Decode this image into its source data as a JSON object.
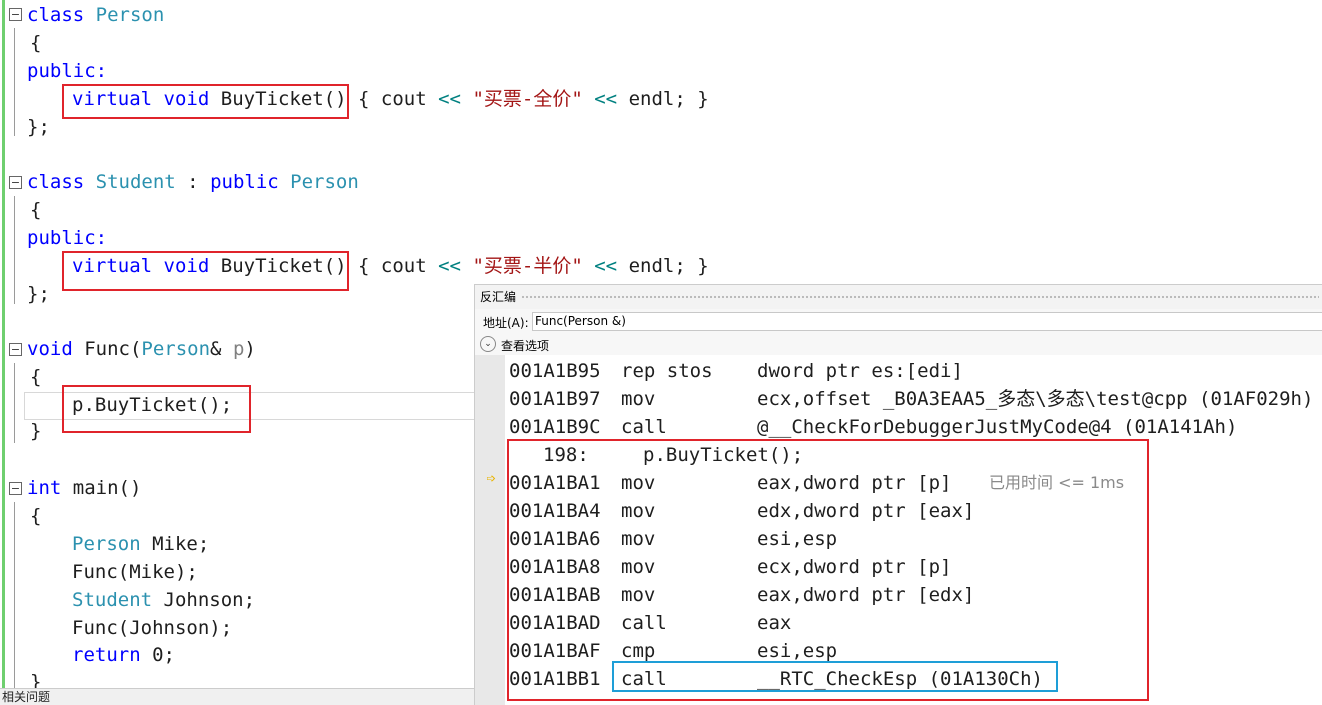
{
  "code": {
    "person_class": {
      "line1": {
        "kw": "class",
        "name": "Person"
      },
      "open": "{",
      "access": "public:",
      "method": {
        "virtual": "virtual",
        "void": "void",
        "name": "BuyTicket()",
        "body_open": " { cout ",
        "op1": "<<",
        "str": "\"买票-全价\"",
        "op2": "<<",
        "tail": " endl; }"
      },
      "close": "};"
    },
    "student_class": {
      "line1": {
        "kw": "class",
        "name": "Student",
        "colon": " : ",
        "public": "public",
        "base": "Person"
      },
      "open": "{",
      "access": "public:",
      "method": {
        "virtual": "virtual",
        "void": "void",
        "name": "BuyTicket()",
        "body_open": " { cout ",
        "op1": "<<",
        "str": "\"买票-半价\"",
        "op2": "<<",
        "tail": " endl; }"
      },
      "close": "};"
    },
    "func": {
      "sig": {
        "void": "void",
        "name": " Func(",
        "type": "Person",
        "amp": "& ",
        "param": "p",
        "close": ")"
      },
      "open": "{",
      "call": "p.BuyTicket();",
      "close": "}"
    },
    "main": {
      "sig": {
        "int": "int",
        "rest": " main()"
      },
      "open": "{",
      "l1": {
        "type": "Person",
        "rest": " Mike;"
      },
      "l2": "Func(Mike);",
      "l3": {
        "type": "Student",
        "rest": " Johnson;"
      },
      "l4": "Func(Johnson);",
      "l5": {
        "kw": "return",
        "rest": " 0;"
      },
      "close": "}"
    }
  },
  "status_text": "相关问题",
  "disassembly": {
    "title": "反汇编",
    "address_label": "地址(A):",
    "address_value": "Func(Person &)",
    "view_options": "查看选项",
    "view_icon": "chevron-down-icon",
    "current_arrow_icon": "current-instruction-arrow-icon",
    "lines": [
      {
        "addr": "001A1B95",
        "mnem": "rep stos",
        "ops": "dword ptr es:[edi]"
      },
      {
        "addr": "001A1B97",
        "mnem": "mov",
        "ops": "ecx,offset _B0A3EAA5_多态\\多态\\test@cpp (01AF029h)"
      },
      {
        "addr": "001A1B9C",
        "mnem": "call",
        "ops": "@__CheckForDebuggerJustMyCode@4 (01A141Ah)"
      }
    ],
    "source_line": {
      "num": "198:",
      "code": "p.BuyTicket();"
    },
    "block_lines": [
      {
        "addr": "001A1BA1",
        "mnem": "mov",
        "ops": "eax,dword ptr [p]",
        "note": "已用时间 <= 1ms"
      },
      {
        "addr": "001A1BA4",
        "mnem": "mov",
        "ops": "edx,dword ptr [eax]"
      },
      {
        "addr": "001A1BA6",
        "mnem": "mov",
        "ops": "esi,esp"
      },
      {
        "addr": "001A1BA8",
        "mnem": "mov",
        "ops": "ecx,dword ptr [p]"
      },
      {
        "addr": "001A1BAB",
        "mnem": "mov",
        "ops": "eax,dword ptr [edx]"
      },
      {
        "addr": "001A1BAD",
        "mnem": "call",
        "ops": "eax"
      },
      {
        "addr": "001A1BAF",
        "mnem": "cmp",
        "ops": "esi,esp"
      },
      {
        "addr": "001A1BB1",
        "mnem": "call",
        "ops": "__RTC_CheckEsp (01A130Ch)"
      }
    ]
  },
  "colors": {
    "keyword": "#0000ff",
    "type": "#2b91af",
    "string": "#a31515",
    "highlight_red": "#e0242b",
    "highlight_blue": "#1e9ed7"
  }
}
